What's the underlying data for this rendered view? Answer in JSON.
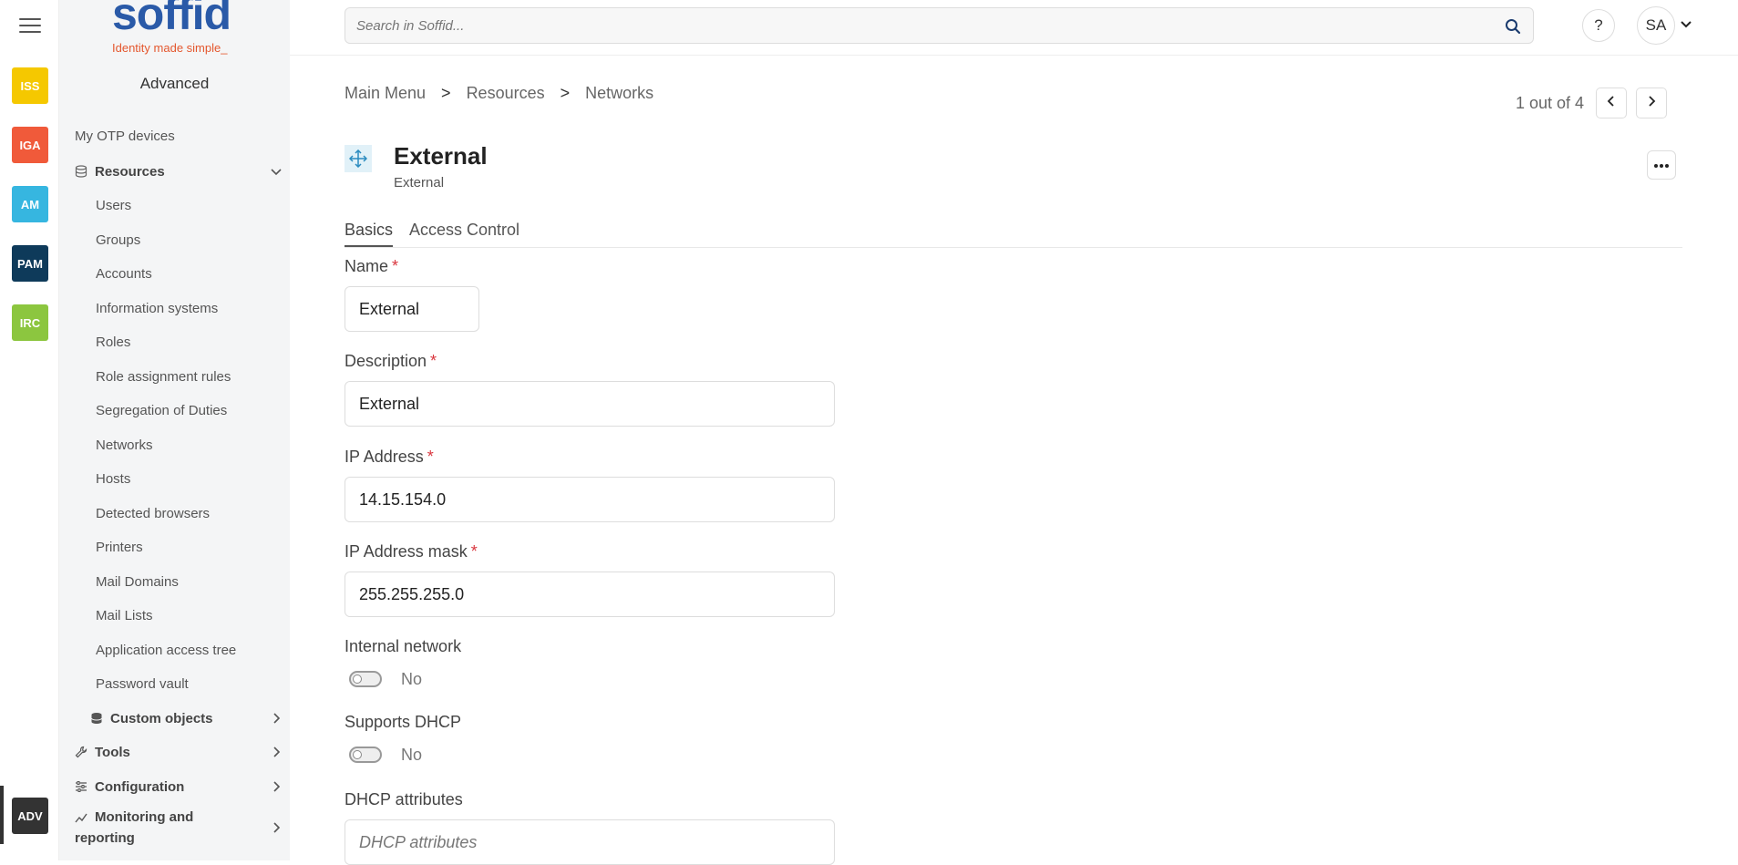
{
  "rail": {
    "apps": [
      {
        "label": "ISS",
        "color": "#f5c800"
      },
      {
        "label": "IGA",
        "color": "#f05a3a"
      },
      {
        "label": "AM",
        "color": "#36b6e0"
      },
      {
        "label": "PAM",
        "color": "#0e3a5a"
      },
      {
        "label": "IRC",
        "color": "#8cc63f"
      },
      {
        "label": "ADV",
        "color": "#333333"
      }
    ]
  },
  "logo": {
    "word": "soffid",
    "tagline": "Identity made simple_"
  },
  "sidebar": {
    "title": "Advanced",
    "items": [
      {
        "label": "My OTP devices",
        "level": 1,
        "bold": false
      },
      {
        "label": "Resources",
        "level": 1,
        "bold": true,
        "icon": "database-icon",
        "expanded": true
      },
      {
        "label": "Users",
        "level": 2
      },
      {
        "label": "Groups",
        "level": 2
      },
      {
        "label": "Accounts",
        "level": 2
      },
      {
        "label": "Information systems",
        "level": 2
      },
      {
        "label": "Roles",
        "level": 2
      },
      {
        "label": "Role assignment rules",
        "level": 2
      },
      {
        "label": "Segregation of Duties",
        "level": 2
      },
      {
        "label": "Networks",
        "level": 2
      },
      {
        "label": "Hosts",
        "level": 2
      },
      {
        "label": "Detected browsers",
        "level": 2
      },
      {
        "label": "Printers",
        "level": 2
      },
      {
        "label": "Mail Domains",
        "level": 2
      },
      {
        "label": "Mail Lists",
        "level": 2
      },
      {
        "label": "Application access tree",
        "level": 2
      },
      {
        "label": "Password vault",
        "level": 2
      },
      {
        "label": "Custom objects",
        "level": 2,
        "bold": true,
        "icon": "database-icon"
      },
      {
        "label": "Tools",
        "level": 1,
        "bold": true,
        "icon": "wrench-icon"
      },
      {
        "label": "Configuration",
        "level": 1,
        "bold": true,
        "icon": "sliders-icon"
      },
      {
        "label": "Monitoring and reporting",
        "level": 1,
        "bold": true,
        "icon": "chart-line-icon"
      }
    ]
  },
  "header": {
    "search_placeholder": "Search in Soffid...",
    "help_label": "?",
    "user_initials": "SA"
  },
  "breadcrumb": {
    "items": [
      "Main Menu",
      "Resources",
      "Networks"
    ],
    "separator": ">"
  },
  "pager": {
    "text": "1 out of 4"
  },
  "object": {
    "title": "External",
    "subtitle": "External",
    "icon": "network-move-icon"
  },
  "tabs": [
    {
      "label": "Basics",
      "active": true
    },
    {
      "label": "Access Control",
      "active": false
    }
  ],
  "form": {
    "name": {
      "label": "Name",
      "value": "External"
    },
    "description": {
      "label": "Description",
      "value": "External"
    },
    "ip_address": {
      "label": "IP Address",
      "value": "14.15.154.0"
    },
    "ip_mask": {
      "label": "IP Address mask",
      "value": "255.255.255.0"
    },
    "internal_network": {
      "label": "Internal network",
      "value": "No"
    },
    "supports_dhcp": {
      "label": "Supports DHCP",
      "value": "No"
    },
    "dhcp_attributes": {
      "label": "DHCP attributes",
      "placeholder": "DHCP attributes"
    },
    "required_mark": "*"
  }
}
